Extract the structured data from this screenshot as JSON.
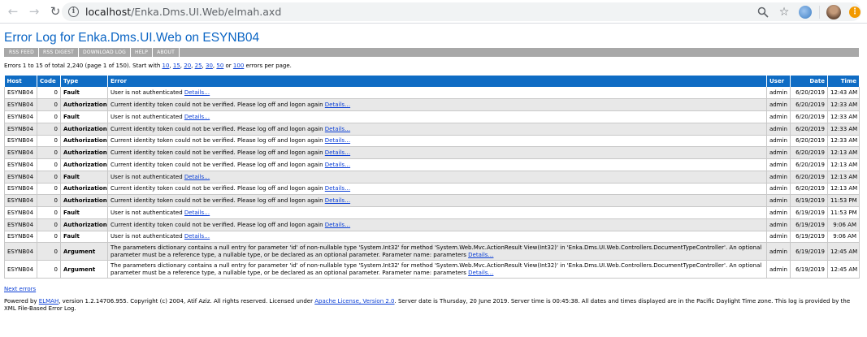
{
  "browser": {
    "url_host": "localhost",
    "url_path": "/Enka.Dms.UI.Web/elmah.axd",
    "info_glyph": "i"
  },
  "page": {
    "title": "Error Log for Enka.Dms.UI.Web on ESYNB04"
  },
  "speedbar": {
    "items": [
      "RSS FEED",
      "RSS DIGEST",
      "DOWNLOAD LOG",
      "HELP",
      "ABOUT"
    ]
  },
  "summary": {
    "prefix": "Errors 1 to 15 of total 2,240 (page 1 of 150). Start with ",
    "page_sizes": [
      "10",
      "15",
      "20",
      "25",
      "30",
      "50"
    ],
    "or": " or ",
    "last": "100",
    "suffix": " errors per page."
  },
  "table": {
    "headers": {
      "host": "Host",
      "code": "Code",
      "type": "Type",
      "error": "Error",
      "user": "User",
      "date": "Date",
      "time": "Time"
    },
    "details_label": "Details…",
    "rows": [
      {
        "host": "ESYNB04",
        "code": "0",
        "type": "Fault",
        "message": "User is not authenticated",
        "user": "admin",
        "date": "6/20/2019",
        "time": "12:43 AM"
      },
      {
        "host": "ESYNB04",
        "code": "0",
        "type": "Authorization",
        "message": "Current identity token could not be verified. Please log off and logon again",
        "user": "admin",
        "date": "6/20/2019",
        "time": "12:33 AM"
      },
      {
        "host": "ESYNB04",
        "code": "0",
        "type": "Fault",
        "message": "User is not authenticated",
        "user": "admin",
        "date": "6/20/2019",
        "time": "12:33 AM"
      },
      {
        "host": "ESYNB04",
        "code": "0",
        "type": "Authorization",
        "message": "Current identity token could not be verified. Please log off and logon again",
        "user": "admin",
        "date": "6/20/2019",
        "time": "12:33 AM"
      },
      {
        "host": "ESYNB04",
        "code": "0",
        "type": "Authorization",
        "message": "Current identity token could not be verified. Please log off and logon again",
        "user": "admin",
        "date": "6/20/2019",
        "time": "12:33 AM"
      },
      {
        "host": "ESYNB04",
        "code": "0",
        "type": "Authorization",
        "message": "Current identity token could not be verified. Please log off and logon again",
        "user": "admin",
        "date": "6/20/2019",
        "time": "12:13 AM"
      },
      {
        "host": "ESYNB04",
        "code": "0",
        "type": "Authorization",
        "message": "Current identity token could not be verified. Please log off and logon again",
        "user": "admin",
        "date": "6/20/2019",
        "time": "12:13 AM"
      },
      {
        "host": "ESYNB04",
        "code": "0",
        "type": "Fault",
        "message": "User is not authenticated",
        "user": "admin",
        "date": "6/20/2019",
        "time": "12:13 AM"
      },
      {
        "host": "ESYNB04",
        "code": "0",
        "type": "Authorization",
        "message": "Current identity token could not be verified. Please log off and logon again",
        "user": "admin",
        "date": "6/20/2019",
        "time": "12:13 AM"
      },
      {
        "host": "ESYNB04",
        "code": "0",
        "type": "Authorization",
        "message": "Current identity token could not be verified. Please log off and logon again",
        "user": "admin",
        "date": "6/19/2019",
        "time": "11:53 PM"
      },
      {
        "host": "ESYNB04",
        "code": "0",
        "type": "Fault",
        "message": "User is not authenticated",
        "user": "admin",
        "date": "6/19/2019",
        "time": "11:53 PM"
      },
      {
        "host": "ESYNB04",
        "code": "0",
        "type": "Authorization",
        "message": "Current identity token could not be verified. Please log off and logon again",
        "user": "admin",
        "date": "6/19/2019",
        "time": "9:06 AM"
      },
      {
        "host": "ESYNB04",
        "code": "0",
        "type": "Fault",
        "message": "User is not authenticated",
        "user": "admin",
        "date": "6/19/2019",
        "time": "9:06 AM"
      },
      {
        "host": "ESYNB04",
        "code": "0",
        "type": "Argument",
        "message": "The parameters dictionary contains a null entry for parameter 'id' of non-nullable type 'System.Int32' for method 'System.Web.Mvc.ActionResult View(Int32)' in 'Enka.Dms.UI.Web.Controllers.DocumentTypeController'. An optional parameter must be a reference type, a nullable type, or be declared as an optional parameter. Parameter name: parameters",
        "user": "admin",
        "date": "6/19/2019",
        "time": "12:45 AM"
      },
      {
        "host": "ESYNB04",
        "code": "0",
        "type": "Argument",
        "message": "The parameters dictionary contains a null entry for parameter 'id' of non-nullable type 'System.Int32' for method 'System.Web.Mvc.ActionResult View(Int32)' in 'Enka.Dms.UI.Web.Controllers.DocumentTypeController'. An optional parameter must be a reference type, a nullable type, or be declared as an optional parameter. Parameter name: parameters",
        "user": "admin",
        "date": "6/19/2019",
        "time": "12:45 AM"
      }
    ]
  },
  "next_link": "Next errors",
  "footer": {
    "part1": "Powered by ",
    "elmah_link": "ELMAH",
    "part2": ", version 1.2.14706.955. Copyright (c) 2004, Atif Aziz. All rights reserved. Licensed under ",
    "license_link": "Apache License, Version 2.0",
    "part3": ". Server date is Thursday, 20 June 2019. Server time is 00:45:38. All dates and times displayed are in the Pacific Daylight Time zone. This log is provided by the XML File-Based Error Log."
  }
}
